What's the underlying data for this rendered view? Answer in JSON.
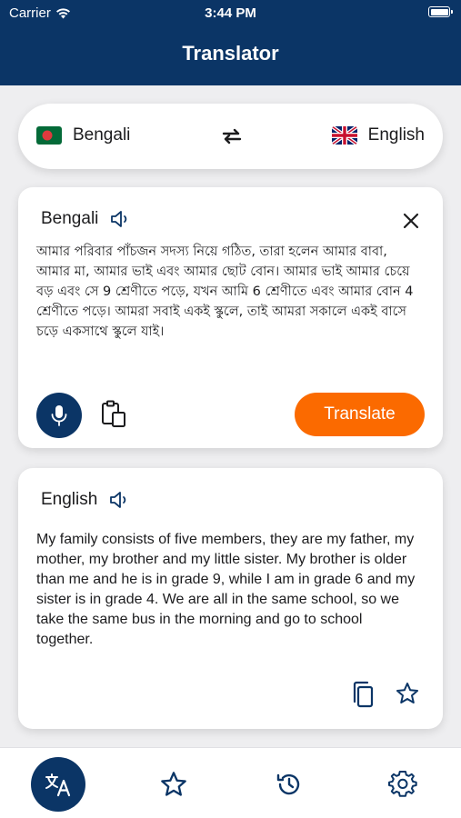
{
  "status_bar": {
    "carrier": "Carrier",
    "time": "3:44 PM"
  },
  "header": {
    "title": "Translator"
  },
  "language_bar": {
    "source": {
      "label": "Bengali",
      "flag": "bangladesh-flag"
    },
    "target": {
      "label": "English",
      "flag": "uk-flag"
    }
  },
  "input_card": {
    "language": "Bengali",
    "text": "আমার পরিবার পাঁচজন সদস্য নিয়ে গঠিত, তারা হলেন আমার বাবা, আমার মা, আমার ভাই এবং আমার ছোট বোন। আমার ভাই আমার চেয়ে বড় এবং সে 9 শ্রেণীতে পড়ে, যখন আমি 6 শ্রেণীতে এবং আমার বোন 4 শ্রেণীতে পড়ে। আমরা সবাই একই স্কুলে, তাই আমরা সকালে একই বাসে চড়ে একসাথে স্কুলে যাই।",
    "translate_label": "Translate"
  },
  "output_card": {
    "language": "English",
    "text": "My family consists of five members, they are my father, my mother, my brother and my little sister. My brother is older than me and he is in grade 9, while I am in grade 6 and my sister is in grade 4. We are all in the same school, so we take the same bus in the morning and go to school together."
  },
  "colors": {
    "primary": "#0b3566",
    "accent": "#fb6a00",
    "background": "#eeeef0"
  },
  "tabbar": {
    "tabs": [
      {
        "name": "translate",
        "icon": "translate-icon",
        "active": true
      },
      {
        "name": "favorites",
        "icon": "star-icon",
        "active": false
      },
      {
        "name": "history",
        "icon": "history-icon",
        "active": false
      },
      {
        "name": "settings",
        "icon": "gear-icon",
        "active": false
      }
    ]
  }
}
